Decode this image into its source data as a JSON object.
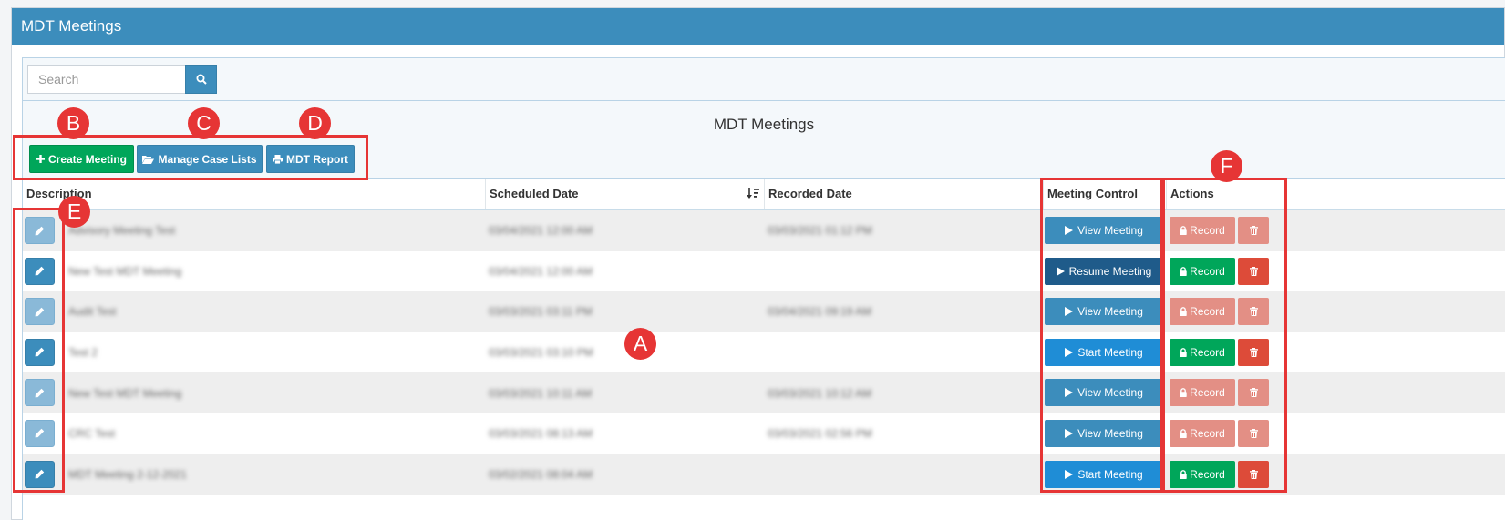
{
  "header": {
    "title": "MDT Meetings"
  },
  "search": {
    "placeholder": "Search",
    "icon": "search-icon"
  },
  "table": {
    "title": "MDT Meetings",
    "columns": {
      "description": "Description",
      "scheduled": "Scheduled Date",
      "recorded": "Recorded Date",
      "meeting_control": "Meeting Control",
      "actions": "Actions"
    },
    "rows": [
      {
        "description": "Advisory Meeting Test",
        "scheduled": "03/04/2021 12:00 AM",
        "recorded": "03/03/2021 01:12 PM",
        "control": "View Meeting",
        "record": "Record"
      },
      {
        "description": "New Test MDT Meeting",
        "scheduled": "03/04/2021 12:00 AM",
        "recorded": "",
        "control": "Resume Meeting",
        "record": "Record"
      },
      {
        "description": "Audit Test",
        "scheduled": "03/03/2021 03:11 PM",
        "recorded": "03/04/2021 09:19 AM",
        "control": "View Meeting",
        "record": "Record"
      },
      {
        "description": "Test 2",
        "scheduled": "03/03/2021 03:10 PM",
        "recorded": "",
        "control": "Start Meeting",
        "record": "Record"
      },
      {
        "description": "New Test MDT Meeting",
        "scheduled": "03/03/2021 10:11 AM",
        "recorded": "03/03/2021 10:12 AM",
        "control": "View Meeting",
        "record": "Record"
      },
      {
        "description": "CRC Test",
        "scheduled": "03/03/2021 08:13 AM",
        "recorded": "03/03/2021 02:56 PM",
        "control": "View Meeting",
        "record": "Record"
      },
      {
        "description": "MDT Meeting 2-12-2021",
        "scheduled": "03/02/2021 08:04 AM",
        "recorded": "",
        "control": "Start Meeting",
        "record": "Record"
      }
    ]
  },
  "toolbar": {
    "create_label": "Create Meeting",
    "manage_label": "Manage Case Lists",
    "report_label": "MDT Report"
  },
  "annotations": {
    "a": "A",
    "b": "B",
    "c": "C",
    "d": "D",
    "e": "E",
    "f": "F"
  },
  "colors": {
    "primary": "#3c8dbc",
    "success": "#00a65a",
    "danger": "#dd4b39",
    "resume": "#1f5b8a",
    "start": "#1f8dd6",
    "annotation": "#e63535"
  }
}
